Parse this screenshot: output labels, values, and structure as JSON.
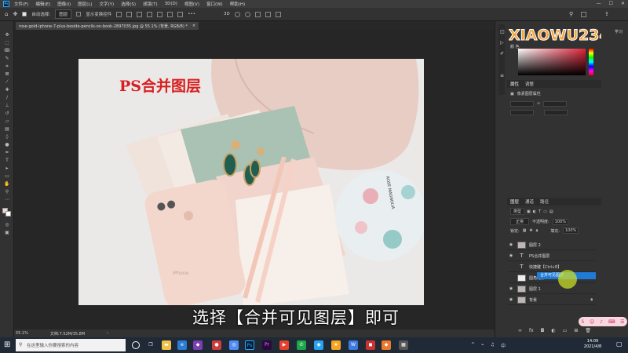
{
  "menubar": {
    "app_icon": "Ps",
    "items": [
      "文件(F)",
      "编辑(E)",
      "图像(I)",
      "图层(L)",
      "文字(Y)",
      "选择(S)",
      "滤镜(T)",
      "3D(D)",
      "视图(V)",
      "窗口(W)",
      "帮助(H)"
    ]
  },
  "options": {
    "auto_select_label": "自动选择:",
    "auto_select_value": "图层",
    "show_transform_label": "显示变换控件"
  },
  "document": {
    "tab_title": "rose-gold-iphone-7-plus-beside-pencils-on-book-2897035.jpg @ 55.1% (背景, RGB/8) *",
    "close_glyph": "×"
  },
  "canvas": {
    "overlay_title": "PS合并图层",
    "phone_label": "iPhone",
    "box_label": "ROSE MAGNOLIA"
  },
  "subtitle": "选择【合并可见图层】即可",
  "statusbar": {
    "zoom": "55.1%",
    "doc_info": "文档:7.52M/35.8M"
  },
  "watermark": "XIAOWU234",
  "panels": {
    "learn_label": "学习",
    "color_letters": "颜 色",
    "properties_tabs": [
      "属性",
      "调整"
    ],
    "properties_item": "像素图层属性",
    "layers_tabs": [
      "图层",
      "通道",
      "路径"
    ],
    "kind_filter": "类型",
    "blend_mode": "正常",
    "opacity_label": "不透明度:",
    "opacity_value": "100%",
    "lock_label": "锁定:",
    "fill_label": "填充:",
    "fill_value": "100%",
    "layers": [
      {
        "name": "图层 2",
        "kind": "pixel"
      },
      {
        "name": "PS合并图层",
        "kind": "text"
      },
      {
        "name": "快捷键【Ctrl+E】",
        "kind": "text"
      },
      {
        "name": "圆角矩形 1",
        "kind": "shape"
      },
      {
        "name": "图层 1",
        "kind": "pixel"
      },
      {
        "name": "背景",
        "kind": "pixel"
      }
    ],
    "context_hint": "合并可见图层"
  },
  "taskbar": {
    "search_placeholder": "在这里输入你要搜索的内容",
    "time": "14:09",
    "date": "2021/4/8"
  },
  "colors": {
    "title_red": "#d81e1e",
    "ps_blue": "#31a8ff",
    "accent_blue": "#1f7bd6"
  }
}
